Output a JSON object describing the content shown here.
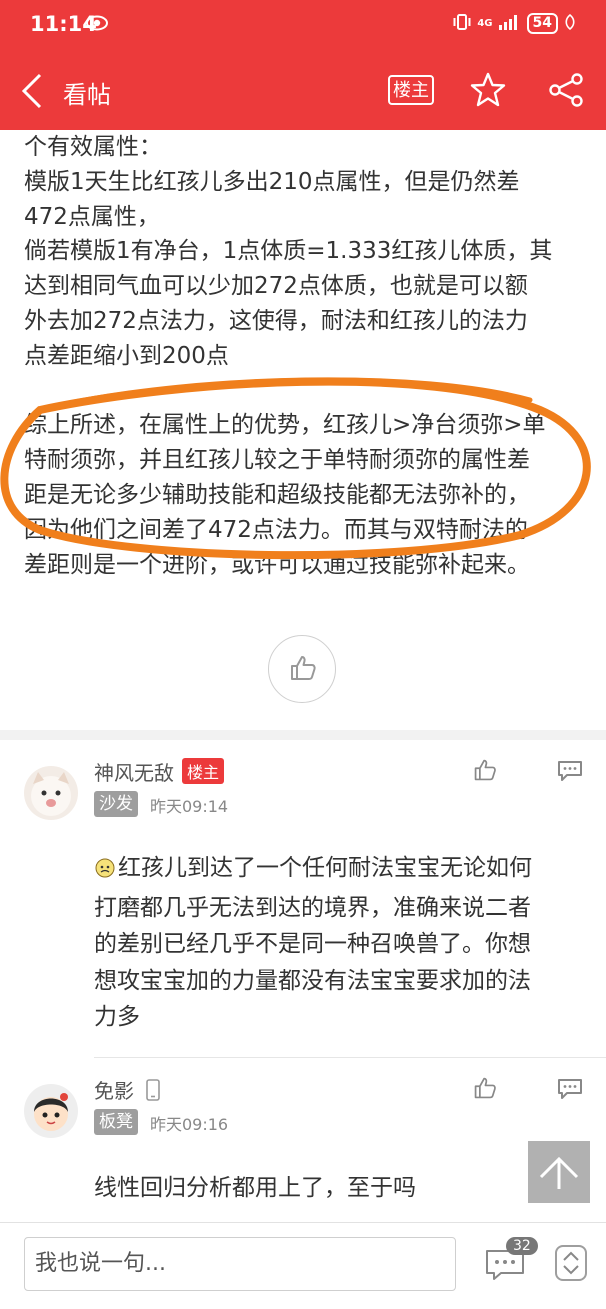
{
  "status": {
    "time": "11:14",
    "network": "4G",
    "battery": "54"
  },
  "nav": {
    "title": "看帖",
    "owner_button": "楼主"
  },
  "article": {
    "lines": [
      "个有效属性：",
      "模版1天生比红孩儿多出210点属性，但是仍然差",
      "472点属性，",
      "倘若模版1有净台，1点体质=1.333红孩儿体质，其",
      "达到相同气血可以少加272点体质，也就是可以额",
      "外去加272点法力，这使得，耐法和红孩儿的法力",
      "点差距缩小到200点"
    ],
    "lines2": [
      "综上所述，在属性上的优势，红孩儿>净台须弥>单",
      "特耐须弥，并且红孩儿较之于单特耐须弥的属性差",
      "距是无论多少辅助技能和超级技能都无法弥补的，",
      "因为他们之间差了472点法力。而其与双特耐法的",
      "差距则是一个进阶，或许可以通过技能弥补起来。"
    ]
  },
  "comments": [
    {
      "name": "神风无敌",
      "badge": "楼主",
      "floor": "沙发",
      "time": "昨天09:14",
      "lines": [
        "红孩儿到达了一个任何耐法宝宝无论如何",
        "打磨都几乎无法到达的境界，准确来说二者",
        "的差别已经几乎不是同一种召唤兽了。你想",
        "想攻宝宝加的力量都没有法宝宝要求加的法",
        "力多"
      ]
    },
    {
      "name": "免影",
      "floor": "板凳",
      "time": "昨天09:16",
      "text": "线性回归分析都用上了，至于吗"
    }
  ],
  "bottom": {
    "placeholder": "我也说一句...",
    "comment_count": "32"
  },
  "colors": {
    "accent": "#ec3a3b",
    "highlight_circle": "#f07f1c"
  }
}
